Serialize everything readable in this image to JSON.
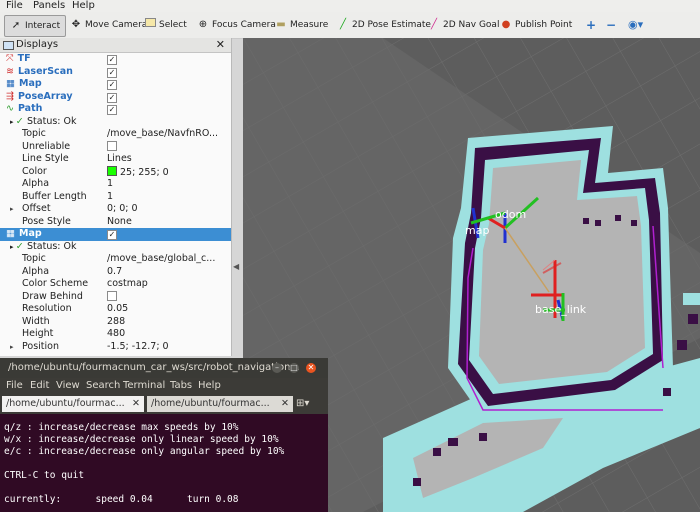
{
  "menubar": {
    "items": [
      "File",
      "Panels",
      "Help"
    ]
  },
  "toolbar": {
    "interact": "Interact",
    "move_camera": "Move Camera",
    "select": "Select",
    "focus_camera": "Focus Camera",
    "measure": "Measure",
    "pose_estimate": "2D Pose Estimate",
    "nav_goal": "2D Nav Goal",
    "publish_point": "Publish Point",
    "icons": [
      "cursor-icon",
      "move-icon",
      "select-icon",
      "focus-icon",
      "ruler-icon",
      "arrow-icon",
      "arrow-icon",
      "pin-icon",
      "plus-icon",
      "minus-icon",
      "eye-icon"
    ]
  },
  "displays": {
    "title": "Displays",
    "rows": [
      {
        "label": "TF",
        "value": "✓",
        "plugin": true,
        "icon": "tf-icon"
      },
      {
        "label": "LaserScan",
        "value": "✓",
        "plugin": true,
        "icon": "laser-icon"
      },
      {
        "label": "Map",
        "value": "✓",
        "plugin": true,
        "icon": "map-icon"
      },
      {
        "label": "PoseArray",
        "value": "✓",
        "plugin": true,
        "icon": "posearray-icon"
      },
      {
        "label": "Path",
        "value": "✓",
        "plugin": true,
        "icon": "path-icon"
      },
      {
        "label": "Status: Ok",
        "value": "",
        "status": true
      },
      {
        "label": "Topic",
        "value": "/move_base/NavfnRO..."
      },
      {
        "label": "Unreliable",
        "value": "",
        "checkbox": true
      },
      {
        "label": "Line Style",
        "value": "Lines"
      },
      {
        "label": "Color",
        "value": "25; 255; 0",
        "swatch": true
      },
      {
        "label": "Alpha",
        "value": "1"
      },
      {
        "label": "Buffer Length",
        "value": "1"
      },
      {
        "label": "Offset",
        "value": "0; 0; 0",
        "expander": true
      },
      {
        "label": "Pose Style",
        "value": "None"
      },
      {
        "label": "Map",
        "value": "✓",
        "plugin": true,
        "selected": true,
        "icon": "map-icon"
      },
      {
        "label": "Status: Ok",
        "value": "",
        "status": true
      },
      {
        "label": "Topic",
        "value": "/move_base/global_c..."
      },
      {
        "label": "Alpha",
        "value": "0.7"
      },
      {
        "label": "Color Scheme",
        "value": "costmap"
      },
      {
        "label": "Draw Behind",
        "value": "",
        "checkbox": true
      },
      {
        "label": "Resolution",
        "value": "0.05"
      },
      {
        "label": "Width",
        "value": "288"
      },
      {
        "label": "Height",
        "value": "480"
      },
      {
        "label": "Position",
        "value": "-1.5; -12.7; 0",
        "expander": true
      }
    ]
  },
  "view": {
    "labels": [
      "odom",
      "map",
      "base_link"
    ],
    "colors": {
      "background": "#5d5d5d",
      "floor": "#b4b4b4",
      "cyan": "#9ee0e0",
      "purple": "#3a0f45",
      "axis_red": "#e02020",
      "axis_green": "#22c022",
      "axis_blue": "#2030d0"
    }
  },
  "terminal": {
    "title": "/home/ubuntu/fourmacnum_car_ws/src/robot_navigation...",
    "menu": [
      "File",
      "Edit",
      "View",
      "Search",
      "Terminal",
      "Tabs",
      "Help"
    ],
    "tabs": [
      "/home/ubuntu/fourmac...",
      "/home/ubuntu/fourmac..."
    ],
    "lines": [
      "q/z : increase/decrease max speeds by 10%",
      "w/x : increase/decrease only linear speed by 10%",
      "e/c : increase/decrease only angular speed by 10%",
      "",
      "CTRL-C to quit",
      "",
      "currently:      speed 0.04      turn 0.08"
    ]
  }
}
